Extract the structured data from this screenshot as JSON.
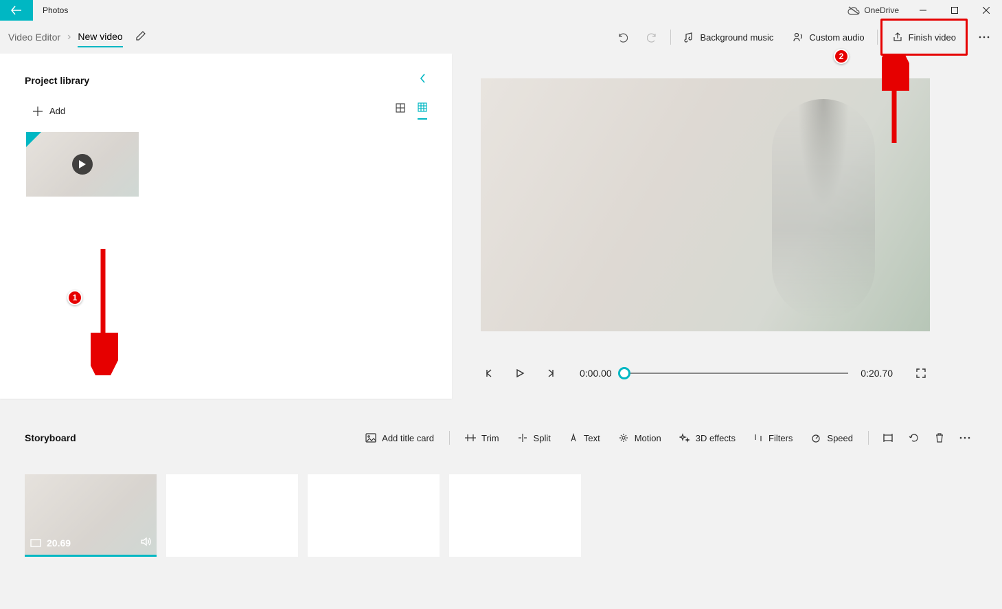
{
  "titlebar": {
    "app": "Photos",
    "onedrive": "OneDrive"
  },
  "breadcrumb": {
    "root": "Video Editor",
    "current": "New video"
  },
  "header": {
    "bg_music": "Background music",
    "custom_audio": "Custom audio",
    "finish": "Finish video"
  },
  "library": {
    "title": "Project library",
    "add": "Add"
  },
  "preview": {
    "time_current": "0:00.00",
    "time_total": "0:20.70"
  },
  "storyboard": {
    "title": "Storyboard",
    "add_title_card": "Add title card",
    "trim": "Trim",
    "split": "Split",
    "text": "Text",
    "motion": "Motion",
    "effects3d": "3D effects",
    "filters": "Filters",
    "speed": "Speed",
    "clip_duration": "20.69"
  },
  "annotations": {
    "badge1": "1",
    "badge2": "2"
  }
}
